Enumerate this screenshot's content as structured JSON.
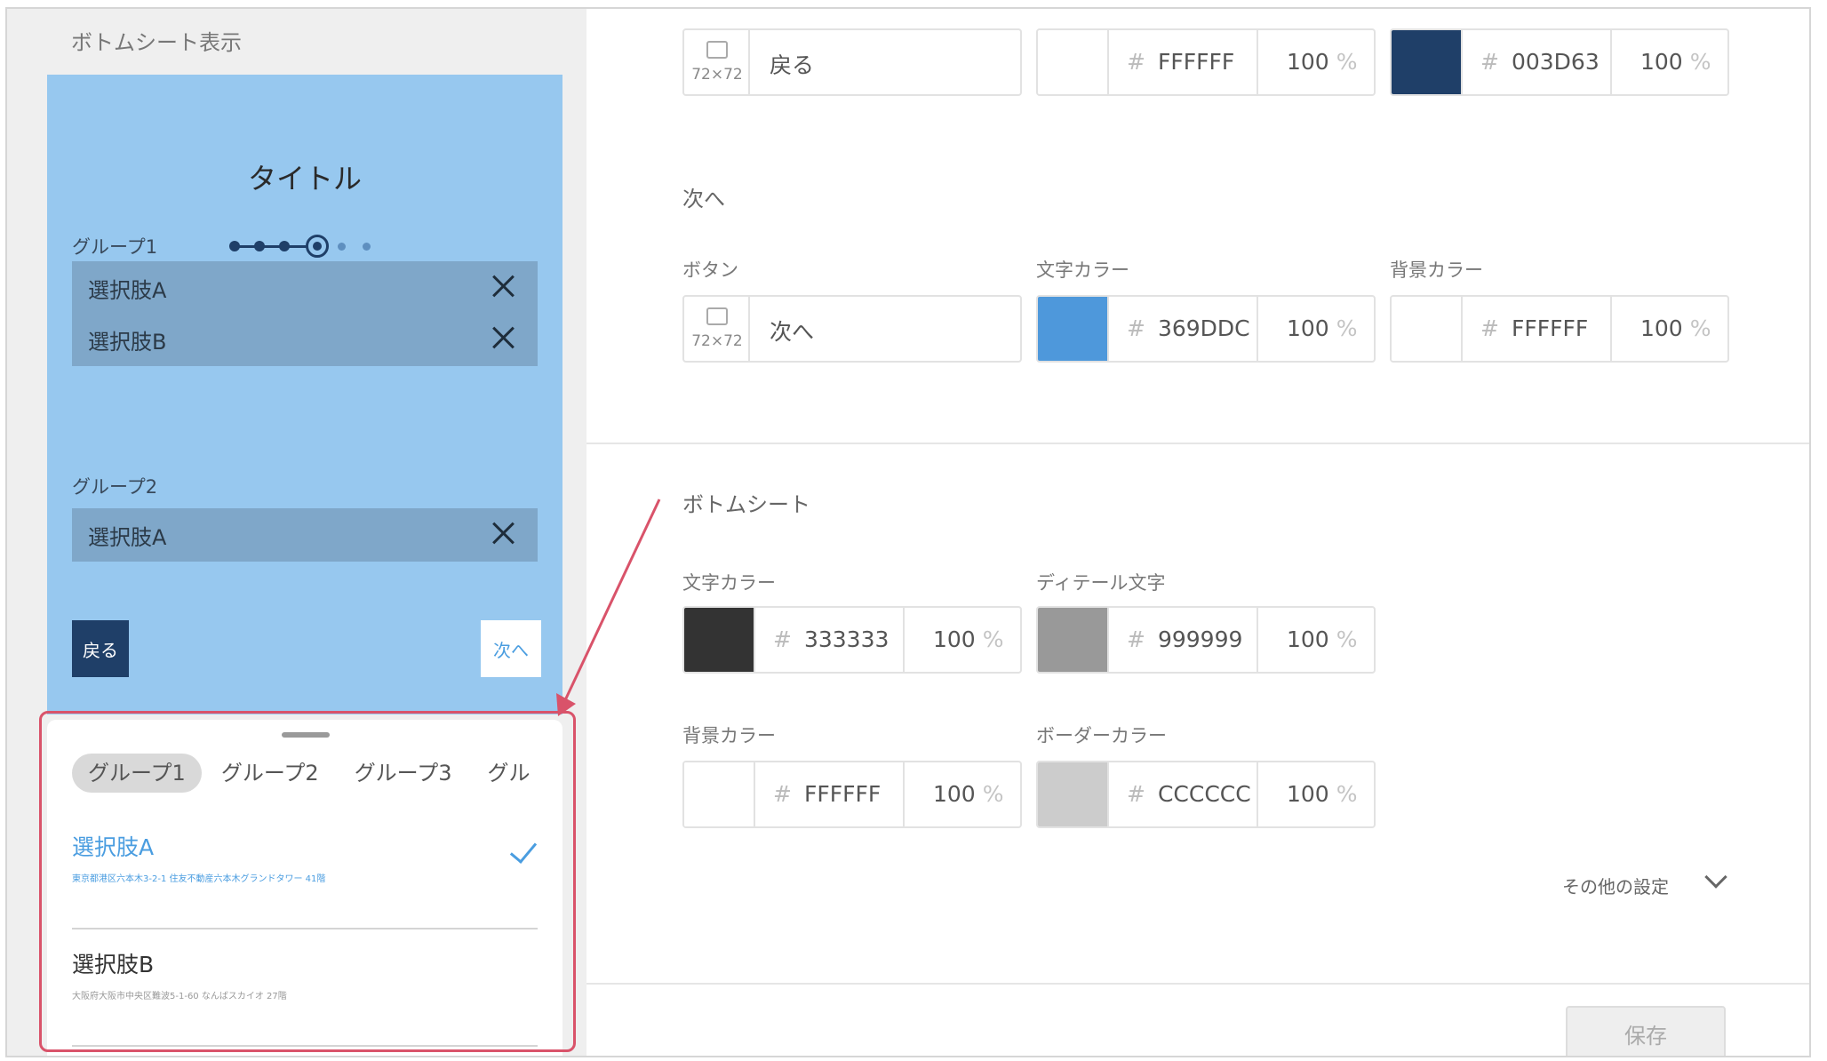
{
  "preview": {
    "title": "ボトムシート表示",
    "screen_title": "タイトル",
    "group1_label": "グループ1",
    "group2_label": "グループ2",
    "chips": [
      "選択肢A",
      "選択肢B",
      "選択肢A"
    ],
    "back_label": "戻る",
    "next_label": "次へ",
    "sheet": {
      "tabs": [
        "グループ1",
        "グループ2",
        "グループ3",
        "グル"
      ],
      "options": [
        {
          "title": "選択肢A",
          "subtitle": "東京都港区六本木3-2-1 住友不動産六本木グランドタワー 41階",
          "selected": true
        },
        {
          "title": "選択肢B",
          "subtitle": "大阪府大阪市中央区難波5-1-60 なんばスカイオ 27階",
          "selected": false
        }
      ]
    }
  },
  "settings": {
    "back_row": {
      "image_size": "72×72",
      "button_text": "戻る",
      "text_color": {
        "hex": "FFFFFF",
        "opacity": "100",
        "swatch": "#ffffff"
      },
      "bg_color": {
        "hex": "003D63",
        "opacity": "100",
        "swatch": "#1f3f68"
      }
    },
    "next_section": {
      "title": "次へ",
      "button_label": "ボタン",
      "text_color_label": "文字カラー",
      "bg_color_label": "背景カラー",
      "image_size": "72×72",
      "button_text": "次へ",
      "text_color": {
        "hex": "369DDC",
        "opacity": "100",
        "swatch": "#4e98db"
      },
      "bg_color": {
        "hex": "FFFFFF",
        "opacity": "100",
        "swatch": "#ffffff"
      }
    },
    "bottom_sheet_section": {
      "title": "ボトムシート",
      "text_color_label": "文字カラー",
      "detail_text_label": "ディテール文字",
      "bg_color_label": "背景カラー",
      "border_color_label": "ボーダーカラー",
      "text_color": {
        "hex": "333333",
        "opacity": "100",
        "swatch": "#333333"
      },
      "detail_color": {
        "hex": "999999",
        "opacity": "100",
        "swatch": "#999999"
      },
      "bg_color": {
        "hex": "FFFFFF",
        "opacity": "100",
        "swatch": "#ffffff"
      },
      "border_color": {
        "hex": "CCCCCC",
        "opacity": "100",
        "swatch": "#cccccc"
      }
    },
    "more_settings": "その他の設定",
    "save_label": "保存",
    "hash_symbol": "#",
    "percent_symbol": "%"
  },
  "colors": {
    "accent": "#4a9de0",
    "highlight": "#d9536a",
    "navy": "#1f3f68",
    "preview_bg": "#97c8ef"
  },
  "icons": [
    "image-placeholder-icon",
    "close-icon",
    "check-icon",
    "chevron-down-icon",
    "annotation-arrow"
  ]
}
